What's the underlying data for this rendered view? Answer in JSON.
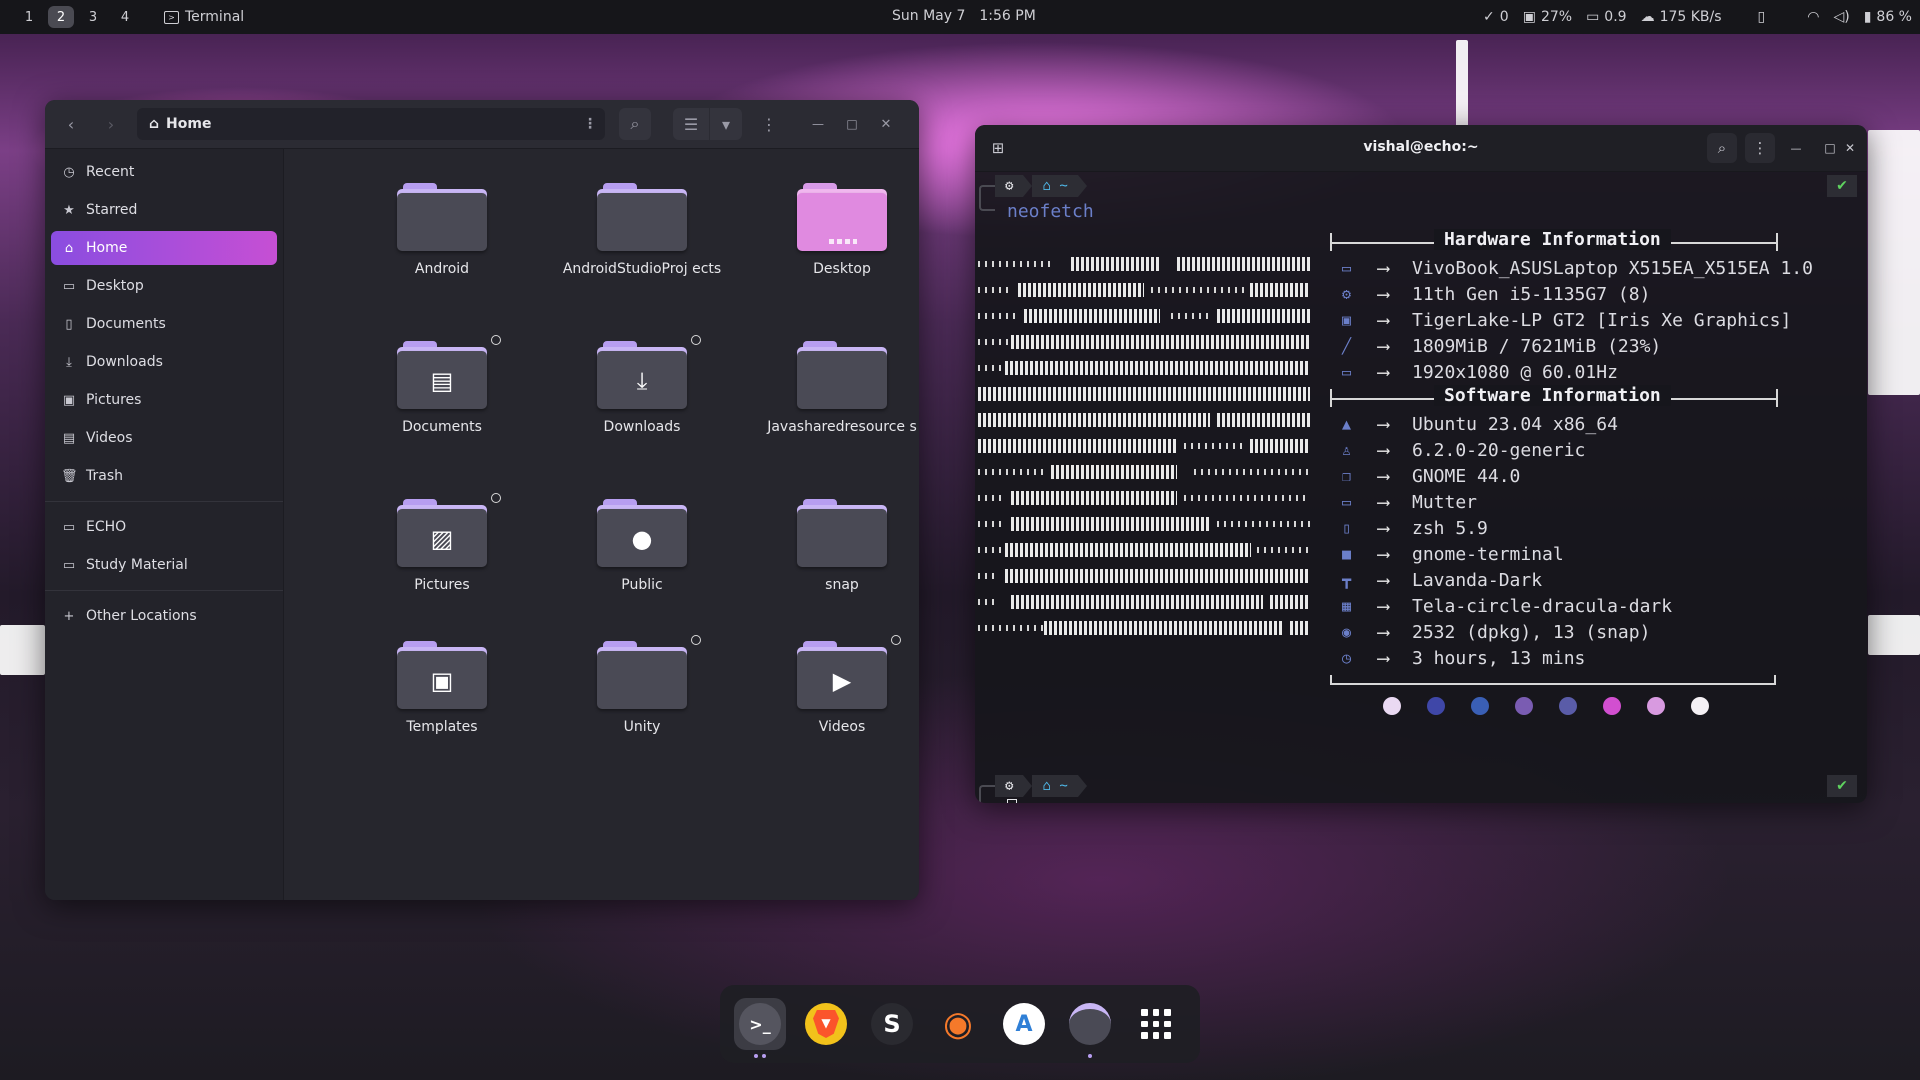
{
  "topbar": {
    "workspaces": [
      "1",
      "2",
      "3",
      "4"
    ],
    "active_workspace": "2",
    "app_icon": "terminal-icon",
    "app_name": "Terminal",
    "date": "Sun May 7",
    "time": "1:56 PM",
    "updates": "0",
    "cpu": "27%",
    "load": "0.9",
    "net": "175 KB/s",
    "battery": "86 %"
  },
  "files": {
    "path": "Home",
    "sidebar": [
      {
        "label": "Recent",
        "icon": "clock-icon"
      },
      {
        "label": "Starred",
        "icon": "star-icon"
      },
      {
        "label": "Home",
        "icon": "home-icon",
        "active": true
      },
      {
        "label": "Desktop",
        "icon": "desktop-icon"
      },
      {
        "label": "Documents",
        "icon": "document-icon"
      },
      {
        "label": "Downloads",
        "icon": "download-icon"
      },
      {
        "label": "Pictures",
        "icon": "picture-icon"
      },
      {
        "label": "Videos",
        "icon": "video-icon"
      },
      {
        "label": "Trash",
        "icon": "trash-icon"
      }
    ],
    "bookmarks": [
      {
        "label": "ECHO",
        "icon": "folder-icon"
      },
      {
        "label": "Study Material",
        "icon": "folder-icon"
      }
    ],
    "other_locations": "Other Locations",
    "items": [
      {
        "name": "Android",
        "glyph": ""
      },
      {
        "name": "AndroidStudioProj ects",
        "glyph": ""
      },
      {
        "name": "Desktop",
        "glyph": "",
        "pink": true
      },
      {
        "name": "Documents",
        "glyph": "document",
        "link": true
      },
      {
        "name": "Downloads",
        "glyph": "download",
        "link": true
      },
      {
        "name": "Javasharedresource s",
        "glyph": ""
      },
      {
        "name": "Pictures",
        "glyph": "picture",
        "link": true
      },
      {
        "name": "Public",
        "glyph": "person"
      },
      {
        "name": "snap",
        "glyph": ""
      },
      {
        "name": "Templates",
        "glyph": "template"
      },
      {
        "name": "Unity",
        "glyph": "",
        "link": true
      },
      {
        "name": "Videos",
        "glyph": "play",
        "link": true
      }
    ]
  },
  "terminal": {
    "title": "vishal@echo:~",
    "home_symbol": "~",
    "command": "neofetch",
    "hardware_title": "Hardware Information",
    "software_title": "Software Information",
    "hardware": [
      {
        "icon": "laptop-icon",
        "value": "VivoBook_ASUSLaptop X515EA_X515EA 1.0"
      },
      {
        "icon": "cpu-icon",
        "value": "11th Gen i5-1135G7 (8)"
      },
      {
        "icon": "gpu-icon",
        "value": "TigerLake-LP GT2 [Iris Xe Graphics]"
      },
      {
        "icon": "memory-icon",
        "value": "1809MiB / 7621MiB (23%)"
      },
      {
        "icon": "monitor-icon",
        "value": "1920x1080 @ 60.01Hz"
      }
    ],
    "software": [
      {
        "icon": "distro-icon",
        "value": "Ubuntu 23.04 x86_64"
      },
      {
        "icon": "kernel-icon",
        "value": "6.2.0-20-generic"
      },
      {
        "icon": "de-icon",
        "value": "GNOME 44.0"
      },
      {
        "icon": "wm-icon",
        "value": "Mutter"
      },
      {
        "icon": "shell-icon",
        "value": "zsh 5.9"
      },
      {
        "icon": "terminal-app-icon",
        "value": "gnome-terminal"
      },
      {
        "icon": "theme-icon",
        "value": "Lavanda-Dark"
      },
      {
        "icon": "icons-icon",
        "value": "Tela-circle-dracula-dark"
      },
      {
        "icon": "package-icon",
        "value": "2532 (dpkg), 13 (snap)"
      },
      {
        "icon": "uptime-icon",
        "value": "3 hours, 13 mins"
      }
    ],
    "palette": [
      "#ead9f2",
      "#3f47a8",
      "#3a5fb5",
      "#7a5cb2",
      "#5a5ca8",
      "#d24fd0",
      "#d89ae0",
      "#f4f0f4"
    ],
    "ok_mark": "✔"
  },
  "dock": [
    {
      "name": "terminal",
      "label": ">_",
      "running": true
    },
    {
      "name": "brave-browser",
      "label": "▼"
    },
    {
      "name": "simplenote",
      "label": "S"
    },
    {
      "name": "blender",
      "label": "◉"
    },
    {
      "name": "android-studio",
      "label": "A"
    },
    {
      "name": "files",
      "label": ""
    },
    {
      "name": "show-apps",
      "label": ""
    }
  ]
}
